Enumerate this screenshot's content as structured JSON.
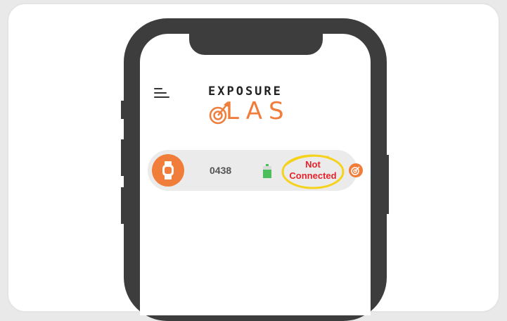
{
  "app": {
    "logo_top": "EXPOSURE",
    "logo_bottom": "LAS",
    "accent_color": "#f07d3a",
    "status_color": "#e5232b",
    "highlight_color": "#f5d21c"
  },
  "device": {
    "id": "0438",
    "status_line1": "Not",
    "status_line2": "Connected",
    "battery_icon": "battery-icon",
    "avatar_icon": "watch-icon",
    "action_icon": "target-icon"
  },
  "nav": {
    "menu_icon": "hamburger-menu-icon"
  }
}
